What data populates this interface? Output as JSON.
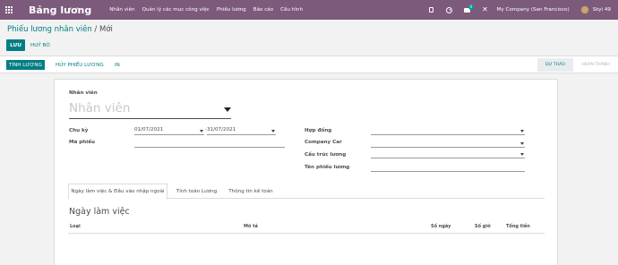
{
  "nav": {
    "brand": "Bảng lương",
    "menu": [
      "Nhân viên",
      "Quản lý các mục công việc",
      "Phiếu lương",
      "Báo cáo",
      "Cấu hình"
    ],
    "chat_badge": "4",
    "company": "My Company (San Francisco)",
    "user": "Skyi 49"
  },
  "breadcrumb": {
    "parent": "Phiếu lương nhân viên",
    "separator": "/",
    "current": "Mới"
  },
  "actions": {
    "save": "LƯU",
    "discard": "HUỶ BỎ"
  },
  "statusbar": {
    "buttons": [
      "TÍNH LƯƠNG",
      "HỦY PHIẾU LƯƠNG",
      "IN"
    ],
    "stages": [
      "DỰ THẢO",
      "HOÀN THÀNH"
    ]
  },
  "form": {
    "employee_label": "Nhân viên",
    "employee_placeholder": "Nhân viên",
    "period_label": "Chu kỳ",
    "date_from": "01/07/2021",
    "date_to": "31/07/2021",
    "date_dash": "-",
    "ref_label": "Mã phiếu",
    "contract_label": "Hợp đồng",
    "company_car_label": "Company Car",
    "structure_label": "Cấu trúc lương",
    "name_label": "Tên phiếu lương"
  },
  "tabs": [
    "Ngày làm việc & Đầu vào nhập ngoài",
    "Tính toán Lương",
    "Thông tin kế toán"
  ],
  "worked_days": {
    "title": "Ngày làm việc",
    "columns": [
      "Loại",
      "Mô tả",
      "Số ngày",
      "Số giờ",
      "Tổng tiền"
    ]
  }
}
